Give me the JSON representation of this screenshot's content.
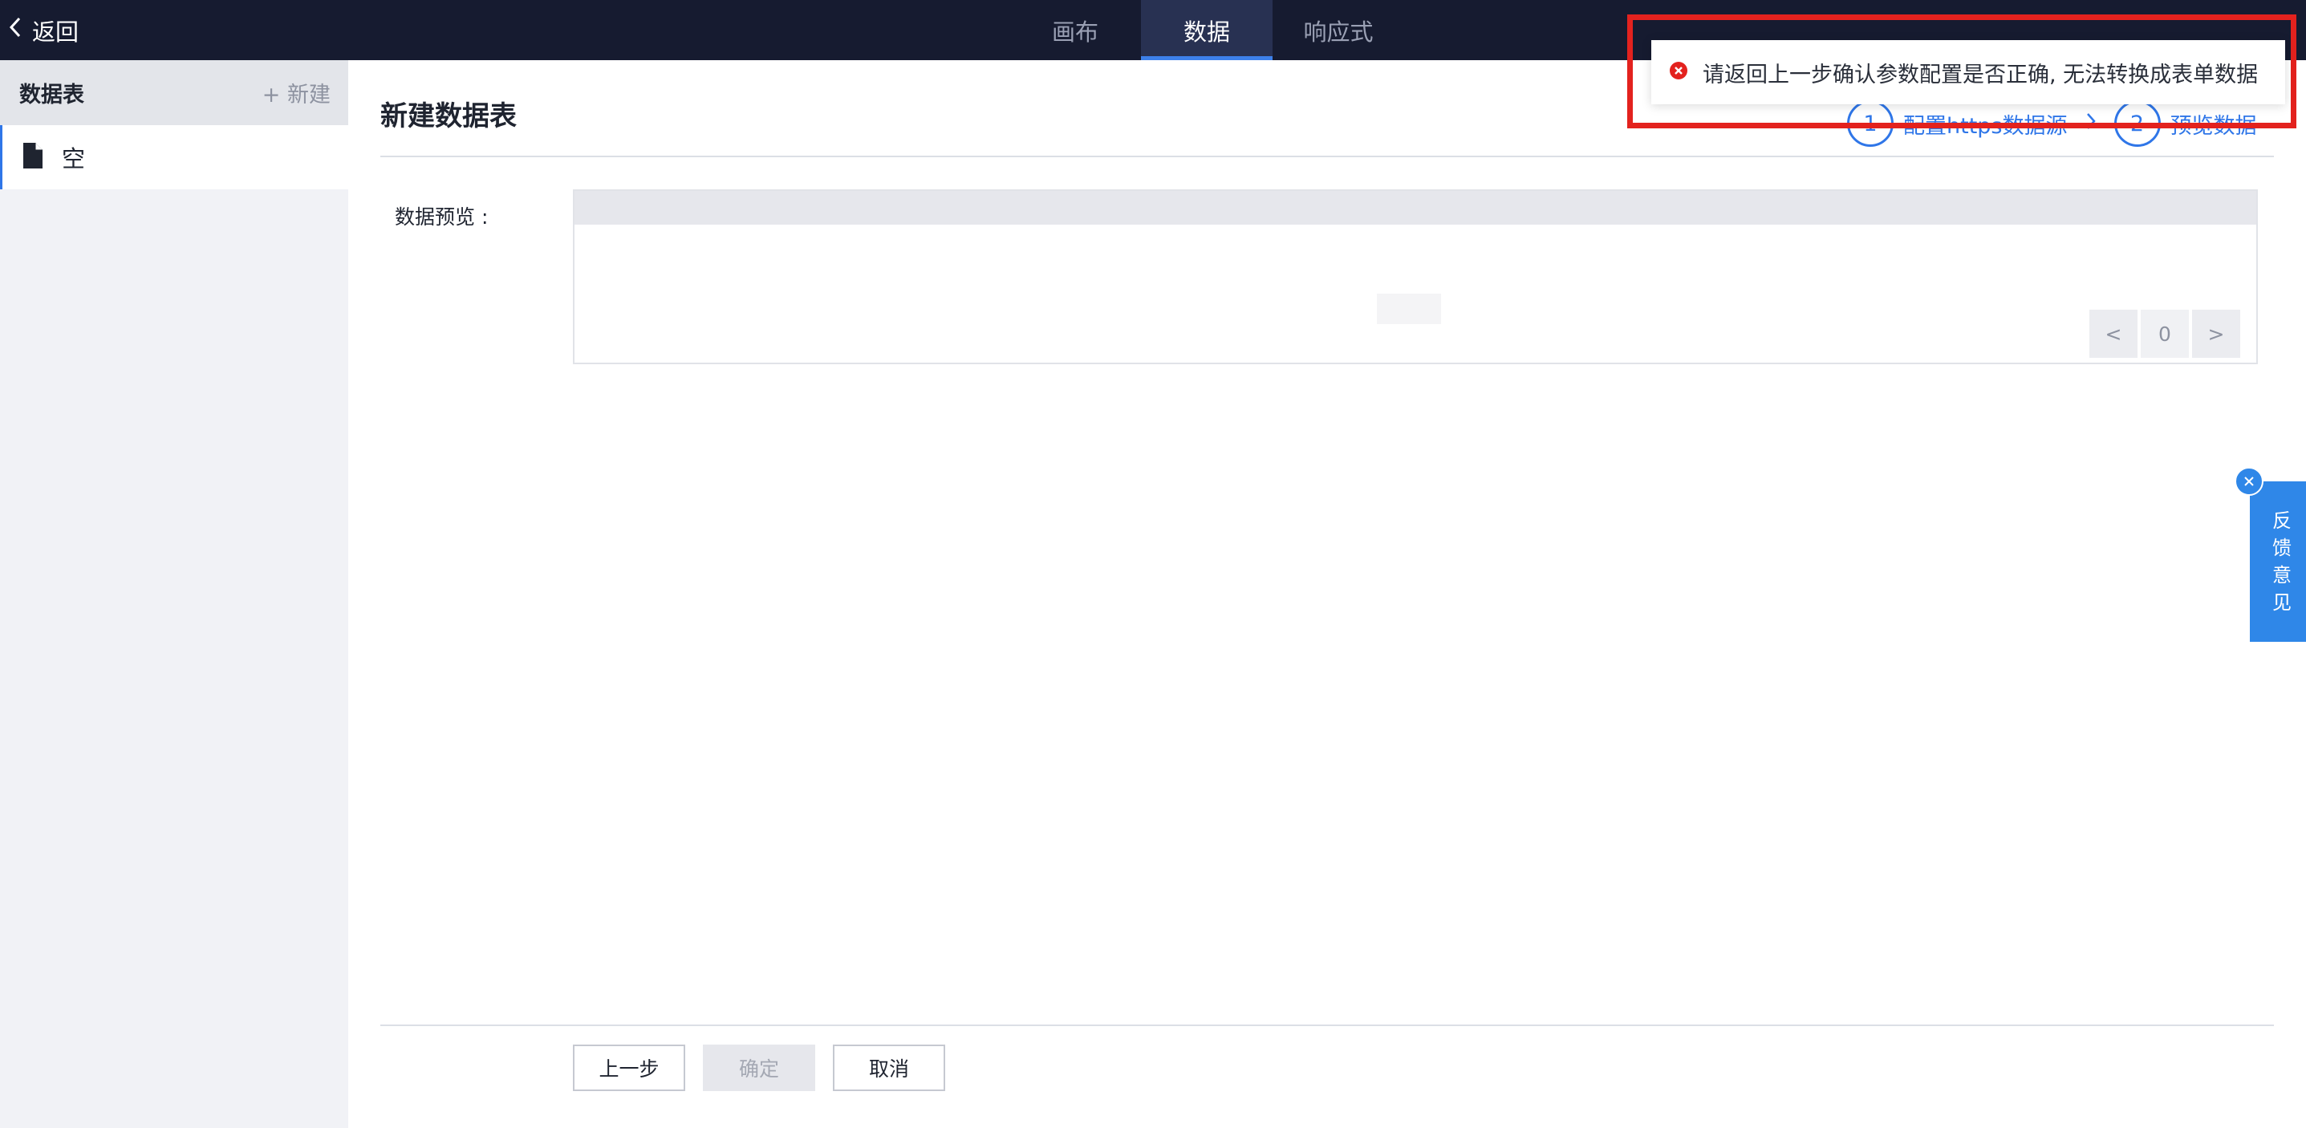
{
  "topbar": {
    "back_label": "返回",
    "tabs": [
      {
        "label": "画布",
        "active": false
      },
      {
        "label": "数据",
        "active": true
      },
      {
        "label": "响应式",
        "active": false
      }
    ]
  },
  "sidebar": {
    "title": "数据表",
    "new_label": "+ 新建",
    "items": [
      {
        "label": "空",
        "icon": "file-icon"
      }
    ]
  },
  "main": {
    "title": "新建数据表",
    "steps": [
      {
        "number": "1",
        "label": "配置https数据源"
      },
      {
        "number": "2",
        "label": "预览数据"
      }
    ],
    "preview_label": "数据预览 :",
    "pager": {
      "prev": "<",
      "page": "0",
      "next": ">"
    },
    "buttons": {
      "prev_step": "上一步",
      "confirm": "确定",
      "cancel": "取消"
    }
  },
  "feedback": {
    "label_chars": [
      "反",
      "馈",
      "意",
      "见"
    ]
  },
  "toast": {
    "message": "请返回上一步确认参数配置是否正确, 无法转换成表单数据",
    "type": "error"
  },
  "colors": {
    "topbar_bg": "#161b30",
    "accent": "#2f76e8",
    "error": "#e3221e",
    "feedback_bg": "#2f87e8"
  }
}
